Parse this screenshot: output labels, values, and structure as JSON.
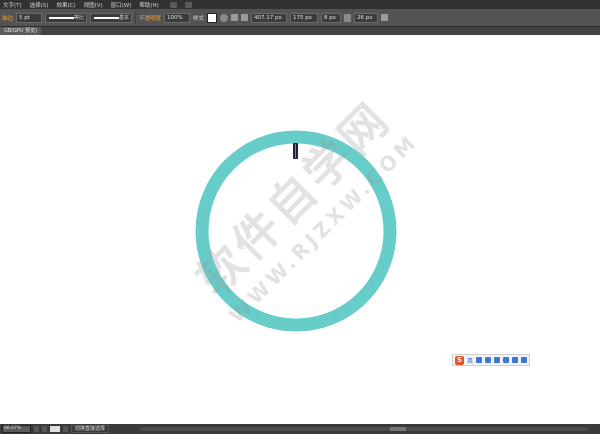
{
  "menu": {
    "items": [
      "文字(T)",
      "选择(S)",
      "效果(C)",
      "视图(V)",
      "窗口(W)",
      "帮助(H)"
    ]
  },
  "control_bar": {
    "stroke_label": "描边",
    "stroke_weight": "5 pt",
    "profile_label": "等比",
    "brush_label": "基本",
    "opacity_label": "不透明度",
    "opacity_value": "100%",
    "style_label": "样式",
    "x_value": "407.17 px",
    "y_value": "175 px",
    "w_value": "8 px",
    "h_value": "26 px"
  },
  "document": {
    "tab_label": "GB/GPU 预览)"
  },
  "canvas": {
    "ring_color": "#66cdc8",
    "marker_color": "#1f2433"
  },
  "watermark": {
    "main": "软件自学网",
    "url": "WWW.RJZXW.COM"
  },
  "ime": {
    "logo": "S",
    "lang": "英"
  },
  "status_bar": {
    "zoom": "66.67%",
    "tool": "切换直接选择"
  }
}
